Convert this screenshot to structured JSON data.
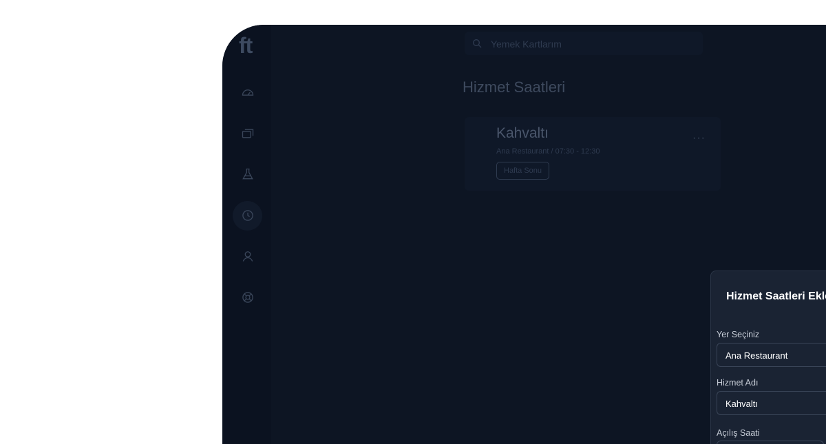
{
  "sidebar": {
    "logo": "ft",
    "items": [
      {
        "icon": "dashboard-gauge-icon",
        "active": false
      },
      {
        "icon": "cards-icon",
        "active": false
      },
      {
        "icon": "flask-icon",
        "active": false
      },
      {
        "icon": "clock-icon",
        "active": true
      },
      {
        "icon": "user-icon",
        "active": false
      },
      {
        "icon": "lifebuoy-icon",
        "active": false
      }
    ]
  },
  "search": {
    "placeholder": "Yemek Kartlarım",
    "icon": "search-icon"
  },
  "page": {
    "title": "Hizmet Saatleri"
  },
  "card": {
    "title": "Kahvaltı",
    "subtitle": "Ana Restaurant / 07:30 - 12:30",
    "tag": "Hafta Sonu",
    "more": "···"
  },
  "modal": {
    "title": "Hizmet Saatleri Ekle",
    "fields": [
      {
        "label": "Yer Seçiniz",
        "value": "Ana Restaurant"
      },
      {
        "label": "Hizmet Adı",
        "value": "Kahvaltı"
      },
      {
        "label": "Açılış Saati",
        "value": ""
      }
    ]
  },
  "colors": {
    "background": "#0d1523",
    "sidebar": "#0b1220",
    "modal": "#1a2333",
    "text_muted": "#3e4a5e"
  }
}
